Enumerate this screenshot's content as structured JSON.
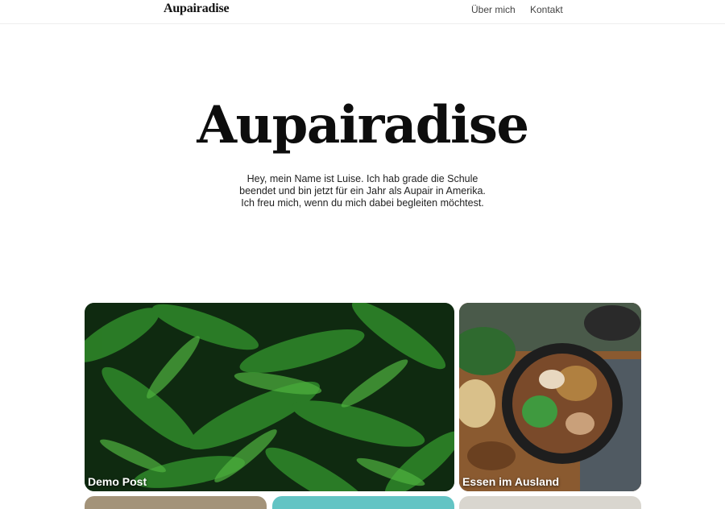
{
  "header": {
    "brand": "Aupairadise",
    "nav": [
      {
        "label": "Über mich"
      },
      {
        "label": "Kontakt"
      }
    ]
  },
  "hero": {
    "title": "Aupairadise",
    "intro_lines": [
      "Hey, mein Name ist Luise. Ich hab grade die Schule",
      "beendet und bin jetzt für ein Jahr als Aupair in Amerika.",
      "Ich freu mich, wenn du mich dabei begleiten möchtest."
    ]
  },
  "posts": [
    {
      "title": "Demo Post",
      "image": "fern-leaves-photo"
    },
    {
      "title": "Essen im Ausland",
      "image": "food-bowl-photo"
    },
    {
      "title": "",
      "image": "partial-photo"
    },
    {
      "title": "",
      "image": "partial-photo"
    },
    {
      "title": "",
      "image": "partial-photo"
    }
  ],
  "colors": {
    "fern_dark": "#0f2a10",
    "fern_green": "#2f8a2a",
    "wood": "#8a5a30",
    "teal": "#63c4c4"
  }
}
